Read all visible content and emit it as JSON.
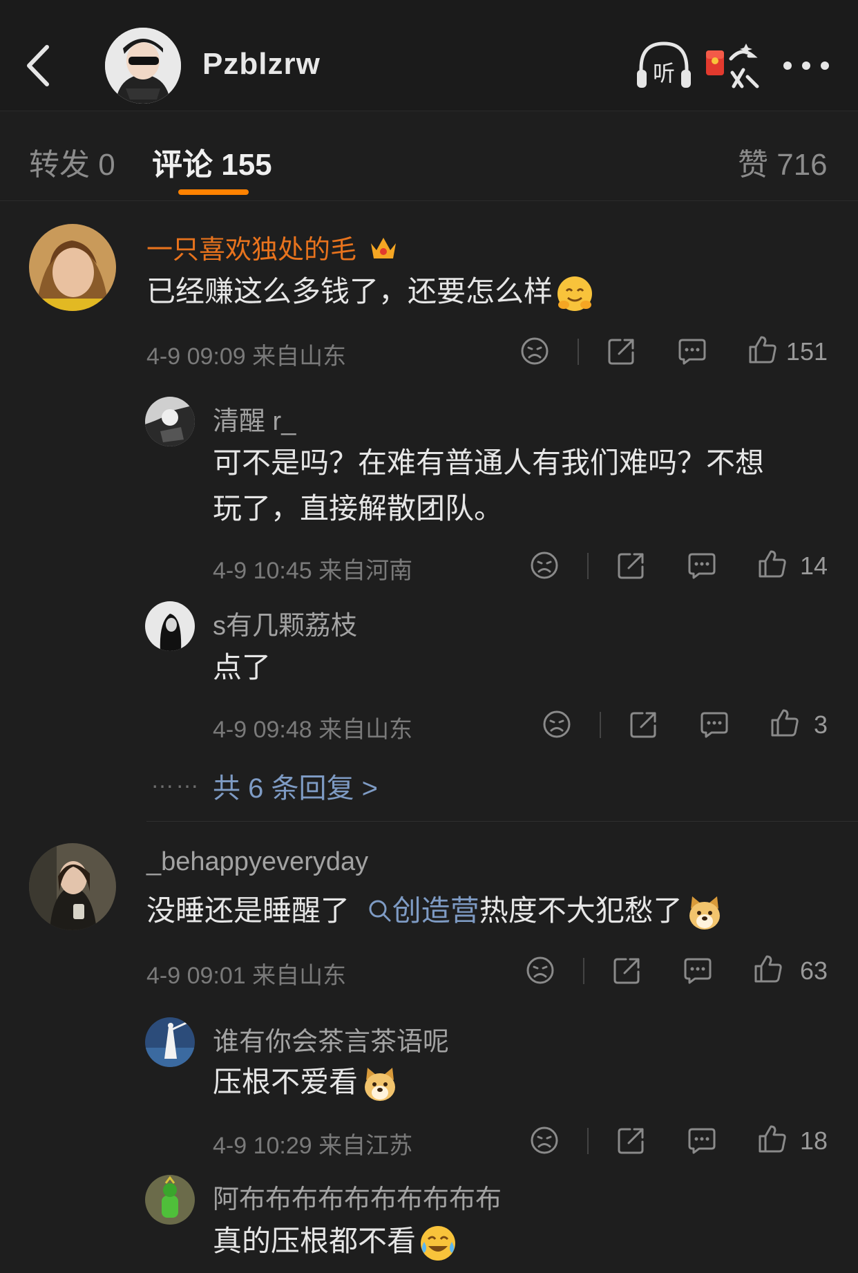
{
  "header": {
    "username": "Pzblzrw",
    "listen_label": "听"
  },
  "tabs": {
    "repost": "转发 0",
    "comments": "评论 155",
    "likes": "赞 716"
  },
  "threads": [
    {
      "user": "一只喜欢独处的毛",
      "text": "已经赚这么多钱了，还要怎么样",
      "time": "4-9 09:09",
      "location": "来自山东",
      "likes": "151",
      "replies": [
        {
          "user": "清醒 r_",
          "text_line1": "可不是吗？在难有普通人有我们难吗？不想",
          "text_line2": "玩了，直接解散团队。",
          "time": "4-9 10:45",
          "location": "来自河南",
          "likes": "14"
        },
        {
          "user": "s有几颗荔枝",
          "text": "点了",
          "time": "4-9 09:48",
          "location": "来自山东",
          "likes": "3"
        }
      ],
      "more_dots": "……",
      "more_replies": "共 6 条回复 >"
    },
    {
      "user": "_behappyeveryday",
      "text_before": "没睡还是睡醒了",
      "topic": "创造营",
      "text_after": "热度不大犯愁了",
      "time": "4-9 09:01",
      "location": "来自山东",
      "likes": "63",
      "replies": [
        {
          "user": "谁有你会茶言茶语呢",
          "text": "压根不爱看",
          "time": "4-9 10:29",
          "location": "来自江苏",
          "likes": "18"
        },
        {
          "user": "阿布布布布布布布布布布",
          "text": "真的压根都不看"
        }
      ]
    }
  ],
  "colors": {
    "accent": "#ff8200",
    "vip_name": "#e8731d",
    "link": "#7e9bc4",
    "background": "#1e1e1e"
  }
}
